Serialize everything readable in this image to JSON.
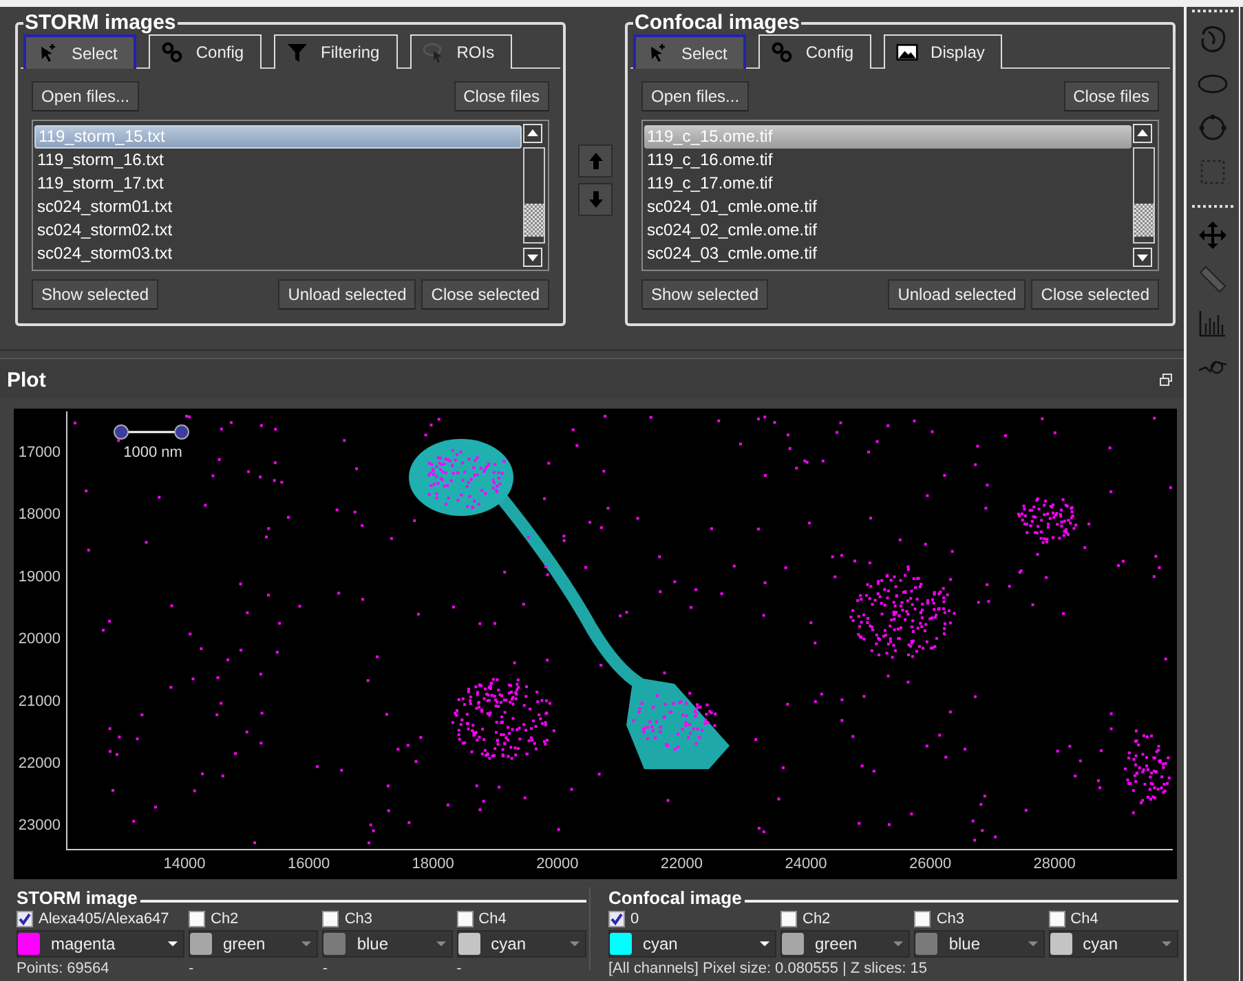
{
  "storm_panel": {
    "title": "STORM images",
    "tabs": [
      {
        "label": "Select",
        "selected": true
      },
      {
        "label": "Config",
        "selected": false
      },
      {
        "label": "Filtering",
        "selected": false
      },
      {
        "label": "ROIs",
        "selected": false
      }
    ],
    "open_button": "Open files...",
    "close_button": "Close files",
    "files": [
      {
        "name": "119_storm_15.txt",
        "selected": true
      },
      {
        "name": "119_storm_16.txt",
        "selected": false
      },
      {
        "name": "119_storm_17.txt",
        "selected": false
      },
      {
        "name": "sc024_storm01.txt",
        "selected": false
      },
      {
        "name": "sc024_storm02.txt",
        "selected": false
      },
      {
        "name": "sc024_storm03.txt",
        "selected": false
      }
    ],
    "show_button": "Show selected",
    "unload_button": "Unload selected",
    "close_selected_button": "Close selected"
  },
  "confocal_panel": {
    "title": "Confocal images",
    "tabs": [
      {
        "label": "Select",
        "selected": true
      },
      {
        "label": "Config",
        "selected": false
      },
      {
        "label": "Display",
        "selected": false
      }
    ],
    "open_button": "Open files...",
    "close_button": "Close files",
    "files": [
      {
        "name": "119_c_15.ome.tif",
        "selected": true
      },
      {
        "name": "119_c_16.ome.tif",
        "selected": false
      },
      {
        "name": "119_c_17.ome.tif",
        "selected": false
      },
      {
        "name": "sc024_01_cmle.ome.tif",
        "selected": false
      },
      {
        "name": "sc024_02_cmle.ome.tif",
        "selected": false
      },
      {
        "name": "sc024_03_cmle.ome.tif",
        "selected": false
      }
    ],
    "show_button": "Show selected",
    "unload_button": "Unload selected",
    "close_selected_button": "Close selected"
  },
  "plot": {
    "title": "Plot",
    "scale_bar": "1000 nm",
    "y_ticks": [
      "17000",
      "18000",
      "19000",
      "20000",
      "21000",
      "22000",
      "23000"
    ],
    "x_ticks": [
      "14000",
      "16000",
      "18000",
      "20000",
      "22000",
      "24000",
      "26000",
      "28000"
    ]
  },
  "storm_image": {
    "title": "STORM image",
    "channels": [
      {
        "label": "Alexa405/Alexa647",
        "checked": true,
        "color": "#ff00ff",
        "color_name": "magenta",
        "stat": "Points: 69564"
      },
      {
        "label": "Ch2",
        "checked": false,
        "color": "#a6a6a6",
        "color_name": "green",
        "stat": "-"
      },
      {
        "label": "Ch3",
        "checked": false,
        "color": "#7a7a7a",
        "color_name": "blue",
        "stat": "-"
      },
      {
        "label": "Ch4",
        "checked": false,
        "color": "#c4c4c4",
        "color_name": "cyan",
        "stat": "-"
      }
    ]
  },
  "confocal_image": {
    "title": "Confocal image",
    "channels": [
      {
        "label": "0",
        "checked": true,
        "color": "#00ffff",
        "color_name": "cyan"
      },
      {
        "label": "Ch2",
        "checked": false,
        "color": "#a6a6a6",
        "color_name": "green"
      },
      {
        "label": "Ch3",
        "checked": false,
        "color": "#7a7a7a",
        "color_name": "blue"
      },
      {
        "label": "Ch4",
        "checked": false,
        "color": "#c4c4c4",
        "color_name": "cyan"
      }
    ],
    "info": "[All channels] Pixel size: 0.080555 | Z slices: 15"
  }
}
